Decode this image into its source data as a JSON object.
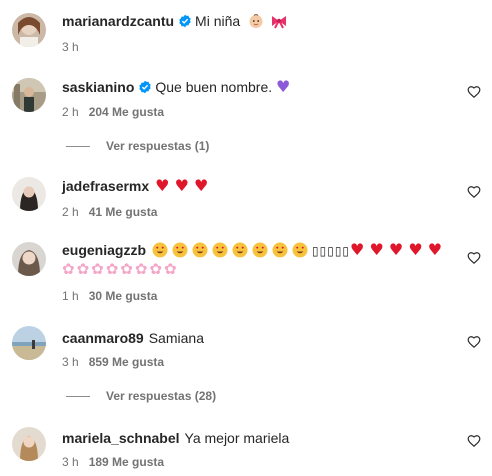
{
  "comments": [
    {
      "username": "marianardzcantu",
      "verified": true,
      "text": "Mi niña",
      "emojis": [
        "baby-emoji",
        "ribbon-emoji"
      ],
      "time": "3 h"
    },
    {
      "username": "saskianino",
      "verified": true,
      "text": "Que buen nombre.",
      "emoji": "♥",
      "time": "2 h",
      "likes": "204 Me gusta",
      "replies": "Ver respuestas (1)"
    },
    {
      "username": "jadefrasermx",
      "verified": false,
      "emoji": "♥ ♥ ♥",
      "time": "2 h",
      "likes": "41 Me gusta"
    },
    {
      "username": "eugeniagzzb",
      "verified": false,
      "boxes": "▯▯▯▯▯",
      "hearts": "♥ ♥ ♥ ♥ ♥",
      "flowers": "✿✿✿✿✿✿✿✿",
      "time": "1 h",
      "likes": "30 Me gusta"
    },
    {
      "username": "caanmaro89",
      "verified": false,
      "text": "Samiana",
      "time": "3 h",
      "likes": "859 Me gusta",
      "replies": "Ver respuestas (28)"
    },
    {
      "username": "mariela_schnabel",
      "verified": false,
      "text": "Ya mejor mariela",
      "time": "3 h",
      "likes": "189 Me gusta"
    }
  ],
  "colors": {
    "text": "#262626",
    "muted": "#737373",
    "verified": "#0095f6",
    "red_heart": "#e0162b",
    "purple_heart": "#8c5ad8"
  }
}
